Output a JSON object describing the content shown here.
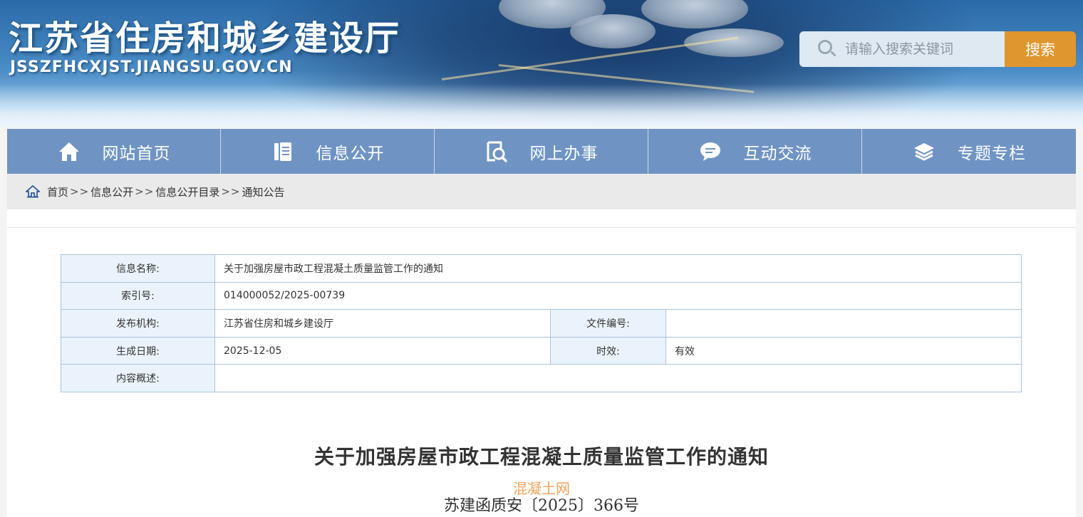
{
  "header": {
    "site_title": "江苏省住房和城乡建设厅",
    "site_domain": "JSSZFHCXJST.JIANGSU.GOV.CN",
    "search": {
      "placeholder": "请输入搜索关键词",
      "button_label": "搜索"
    }
  },
  "nav": {
    "items": [
      {
        "label": "网站首页",
        "icon": "home-icon"
      },
      {
        "label": "信息公开",
        "icon": "document-icon"
      },
      {
        "label": "网上办事",
        "icon": "search-document-icon"
      },
      {
        "label": "互动交流",
        "icon": "chat-bubble-icon"
      },
      {
        "label": "专题专栏",
        "icon": "layers-icon"
      }
    ]
  },
  "breadcrumb": {
    "items": [
      "首页",
      "信息公开",
      "信息公开目录",
      "通知公告"
    ],
    "separator": ">>"
  },
  "info": {
    "name_label": "信息名称:",
    "name_value": "关于加强房屋市政工程混凝土质量监管工作的通知",
    "index_label": "索引号:",
    "index_value": "014000052/2025-00739",
    "publisher_label": "发布机构:",
    "publisher_value": "江苏省住房和城乡建设厅",
    "doc_no_label": "文件编号:",
    "doc_no_value": "",
    "date_label": "生成日期:",
    "date_value": "2025-12-05",
    "validity_label": "时效:",
    "validity_value": "有效",
    "summary_label": "内容概述:",
    "summary_value": ""
  },
  "article": {
    "title": "关于加强房屋市政工程混凝土质量监管工作的通知",
    "watermark": "混凝土网",
    "doc_number": "苏建函质安〔2025〕366号"
  },
  "colors": {
    "nav_bg": "#6f94c4",
    "search_button": "#e0962f",
    "table_border": "#a9c4dc",
    "label_bg": "#eaf3fb",
    "watermark": "#f0a35c"
  }
}
